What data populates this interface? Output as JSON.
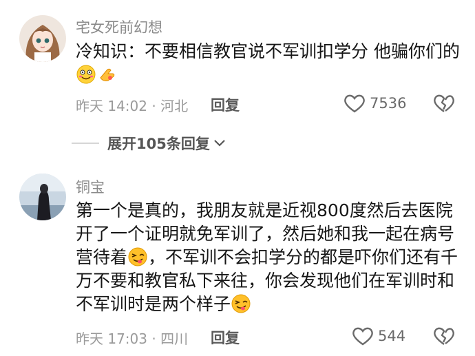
{
  "comments": [
    {
      "username": "宅女死前幻想",
      "text_parts": [
        "冷知识：不要相信教官说不军训扣学分 他骗你们的"
      ],
      "time": "昨天 14:02",
      "location": "河北",
      "reply_label": "回复",
      "likes": "7536"
    },
    {
      "username": "铜宝",
      "text_parts": [
        "第一个是真的，我朋友就是近视800度然后去医院开了一个证明就免军训了，然后她和我一起在病号营待着",
        "，不军训不会扣学分的都是吓你们还有千万不要和教官私下来往，你会发现他们在军训时和不军训时是两个样子"
      ],
      "time": "昨天 17:03",
      "location": "四川",
      "reply_label": "回复",
      "likes": "544"
    }
  ],
  "expand_replies": "展开105条回复",
  "colors": {
    "text": "#161616",
    "meta": "#9a9a9a",
    "icon": "#6a6a6a"
  }
}
